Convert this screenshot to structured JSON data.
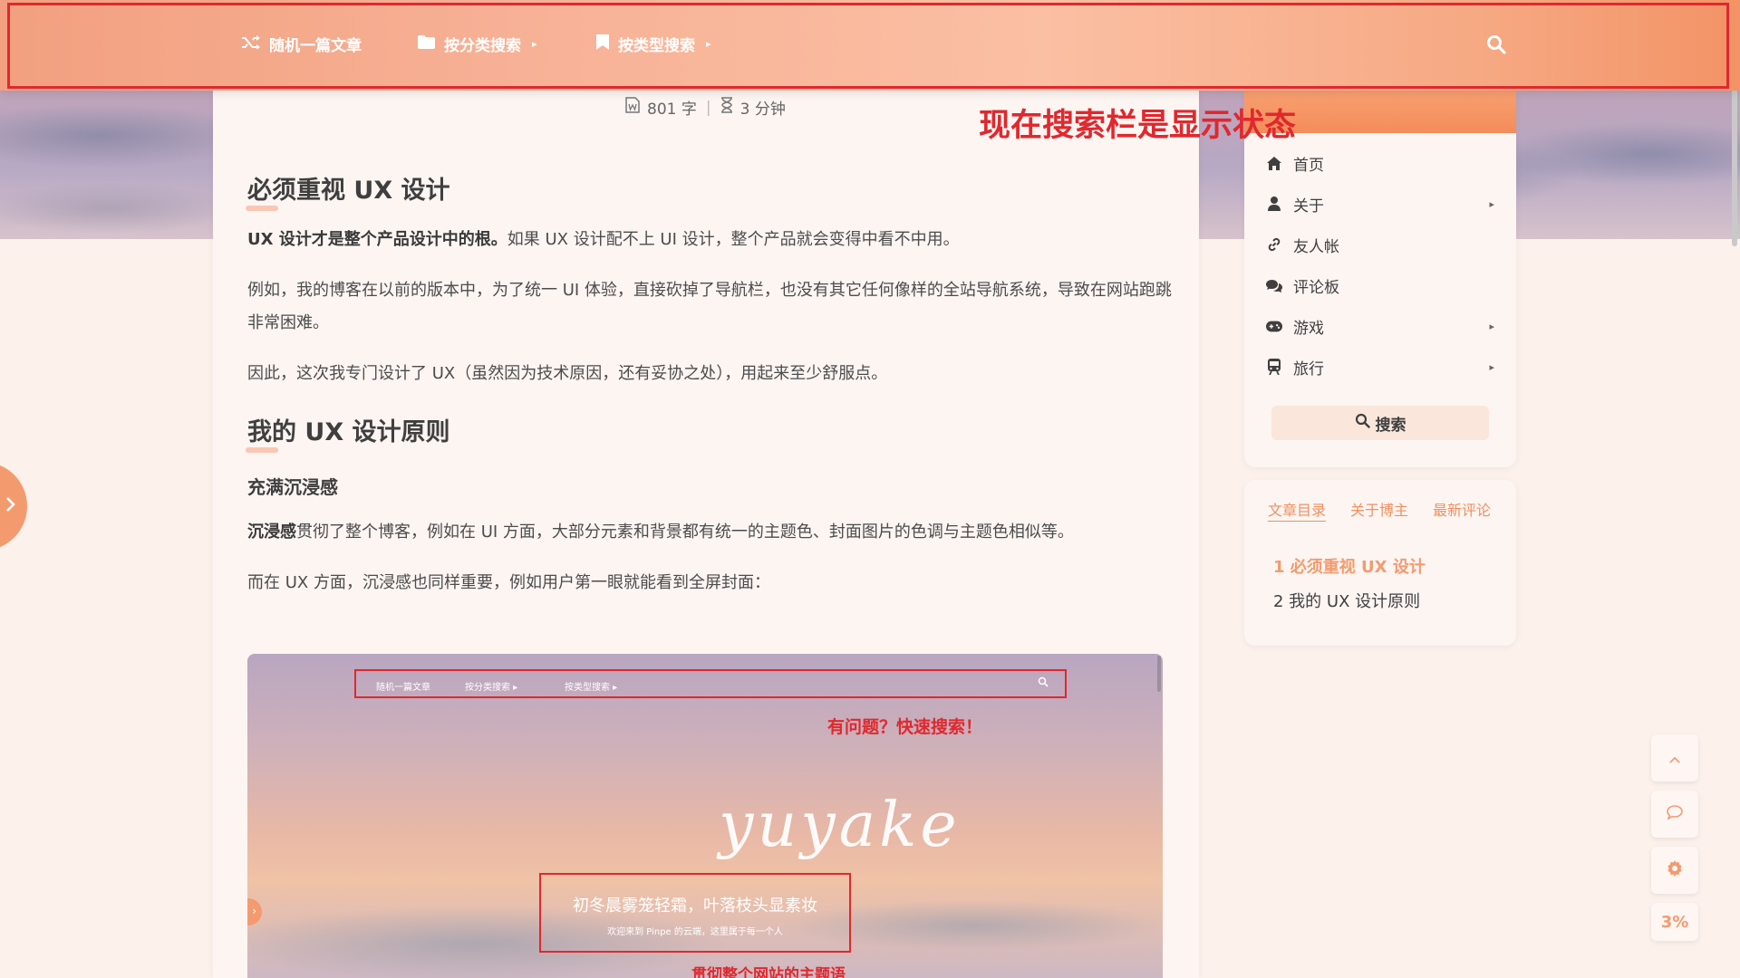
{
  "nav": {
    "items": [
      {
        "label": "随机一篇文章",
        "icon": "shuffle-icon"
      },
      {
        "label": "按分类搜索",
        "icon": "folder-icon",
        "caret": "▸"
      },
      {
        "label": "按类型搜索",
        "icon": "bookmark-icon",
        "caret": "▸"
      }
    ],
    "search_icon": "search-icon"
  },
  "annotation": {
    "top": "现在搜索栏是显示状态"
  },
  "article": {
    "meta": {
      "words": "801 字",
      "sep": "|",
      "time": "3 分钟"
    },
    "h2_1": "必须重视 UX 设计",
    "p1_bold": "UX 设计才是整个产品设计中的根。",
    "p1_rest": "如果 UX 设计配不上 UI 设计，整个产品就会变得中看不中用。",
    "p2": "例如，我的博客在以前的版本中，为了统一 UI 体验，直接砍掉了导航栏，也没有其它任何像样的全站导航系统，导致在网站跑跳非常困难。",
    "p3": "因此，这次我专门设计了 UX（虽然因为技术原因，还有妥协之处），用起来至少舒服点。",
    "h2_2": "我的 UX 设计原则",
    "h3_1": "充满沉浸感",
    "p4_bold": "沉浸感",
    "p4_rest": "贯彻了整个博客，例如在 UI 方面，大部分元素和背景都有统一的主题色、封面图片的色调与主题色相似等。",
    "p5": "而在 UX 方面，沉浸感也同样重要，例如用户第一眼就能看到全屏封面："
  },
  "screenshot": {
    "nav_items": [
      "随机一篇文章",
      "按分类搜索 ▸",
      "按类型搜索 ▸"
    ],
    "annot_search": "有问题？快速搜索！",
    "signature": "yuyake",
    "hero_title": "初冬晨雾笼轻霜，叶落枝头显素妆",
    "hero_sub": "欢迎来到 Pinpe 的云端，这里属于每一个人",
    "annot_bottom": "贯彻整个网站的主题语"
  },
  "sidebar": {
    "menu": [
      {
        "label": "首页",
        "icon": "home-icon",
        "caret": ""
      },
      {
        "label": "关于",
        "icon": "user-icon",
        "caret": "▸"
      },
      {
        "label": "友人帐",
        "icon": "link-icon",
        "caret": ""
      },
      {
        "label": "评论板",
        "icon": "comments-icon",
        "caret": ""
      },
      {
        "label": "游戏",
        "icon": "gamepad-icon",
        "caret": "▸"
      },
      {
        "label": "旅行",
        "icon": "train-icon",
        "caret": "▸"
      }
    ],
    "search_label": "搜索",
    "toc_tabs": [
      "文章目录",
      "关于博主",
      "最新评论"
    ],
    "toc_links": [
      "1 必须重视 UX 设计",
      "2 我的 UX 设计原则"
    ]
  },
  "fabs": {
    "progress": "3%"
  },
  "colors": {
    "accent": "#f39b6f",
    "annotation": "#e0282e"
  }
}
